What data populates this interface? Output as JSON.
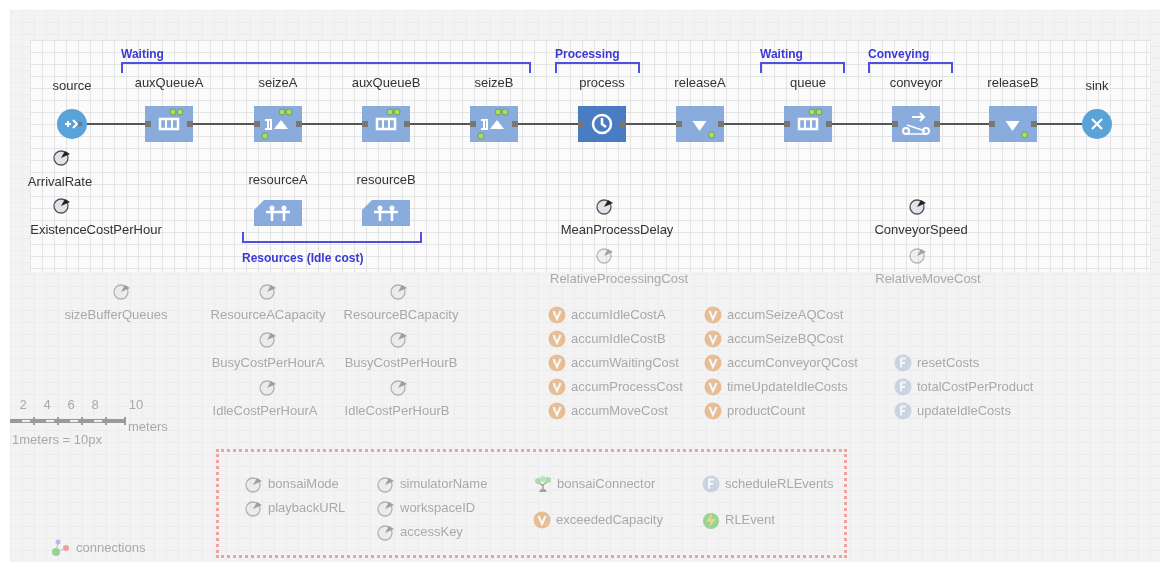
{
  "flowchart": {
    "blocks": [
      {
        "name": "source",
        "kind": "source"
      },
      {
        "name": "auxQueueA",
        "kind": "queue"
      },
      {
        "name": "seizeA",
        "kind": "seize"
      },
      {
        "name": "auxQueueB",
        "kind": "queue"
      },
      {
        "name": "seizeB",
        "kind": "seize"
      },
      {
        "name": "process",
        "kind": "delay"
      },
      {
        "name": "releaseA",
        "kind": "release"
      },
      {
        "name": "queue",
        "kind": "queue"
      },
      {
        "name": "conveyor",
        "kind": "conveyor"
      },
      {
        "name": "releaseB",
        "kind": "release"
      },
      {
        "name": "sink",
        "kind": "sink"
      }
    ],
    "brackets": [
      {
        "label": "Waiting",
        "kind": "top"
      },
      {
        "label": "Processing",
        "kind": "top"
      },
      {
        "label": "Waiting",
        "kind": "top"
      },
      {
        "label": "Conveying",
        "kind": "top"
      },
      {
        "label": "Resources (Idle cost)",
        "kind": "bottom"
      }
    ],
    "resources": [
      {
        "name": "resourceA"
      },
      {
        "name": "resourceB"
      }
    ]
  },
  "parameters": [
    {
      "name": "ArrivalRate",
      "dimmed": false
    },
    {
      "name": "ExistenceCostPerHour",
      "dimmed": false
    },
    {
      "name": "MeanProcessDelay",
      "dimmed": false
    },
    {
      "name": "ConveyorSpeed",
      "dimmed": false
    },
    {
      "name": "RelativeProcessingCost",
      "dimmed": true
    },
    {
      "name": "RelativeMoveCost",
      "dimmed": true
    },
    {
      "name": "sizeBufferQueues",
      "dimmed": true
    },
    {
      "name": "ResourceACapacity",
      "dimmed": true
    },
    {
      "name": "ResourceBCapacity",
      "dimmed": true
    },
    {
      "name": "BusyCostPerHourA",
      "dimmed": true
    },
    {
      "name": "BusyCostPerHourB",
      "dimmed": true
    },
    {
      "name": "IdleCostPerHourA",
      "dimmed": true
    },
    {
      "name": "IdleCostPerHourB",
      "dimmed": true
    }
  ],
  "elements": [
    {
      "kind": "variable",
      "name": "accumIdleCostA"
    },
    {
      "kind": "variable",
      "name": "accumIdleCostB"
    },
    {
      "kind": "variable",
      "name": "accumWaitingCost"
    },
    {
      "kind": "variable",
      "name": "accumProcessCost"
    },
    {
      "kind": "variable",
      "name": "accumMoveCost"
    },
    {
      "kind": "variable",
      "name": "accumSeizeAQCost"
    },
    {
      "kind": "variable",
      "name": "accumSeizeBQCost"
    },
    {
      "kind": "variable",
      "name": "accumConveyorQCost"
    },
    {
      "kind": "variable",
      "name": "timeUpdateIdleCosts"
    },
    {
      "kind": "variable",
      "name": "productCount"
    },
    {
      "kind": "function",
      "name": "resetCosts"
    },
    {
      "kind": "function",
      "name": "totalCostPerProduct"
    },
    {
      "kind": "function",
      "name": "updateIdleCosts"
    },
    {
      "kind": "connections",
      "name": "connections"
    }
  ],
  "scale": {
    "ticks": [
      "2",
      "4",
      "6",
      "8",
      "10"
    ],
    "unit": "meters",
    "ratio": "1meters = 10px"
  },
  "rl_group": {
    "elements": [
      {
        "kind": "parameter",
        "name": "bonsaiMode"
      },
      {
        "kind": "parameter",
        "name": "playbackURL"
      },
      {
        "kind": "parameter",
        "name": "simulatorName"
      },
      {
        "kind": "parameter",
        "name": "workspaceID"
      },
      {
        "kind": "parameter",
        "name": "accessKey"
      },
      {
        "kind": "bonsai",
        "name": "bonsaiConnector"
      },
      {
        "kind": "variable",
        "name": "exceededCapacity"
      },
      {
        "kind": "function",
        "name": "scheduleRLEvents"
      },
      {
        "kind": "event",
        "name": "RLEvent"
      }
    ]
  }
}
